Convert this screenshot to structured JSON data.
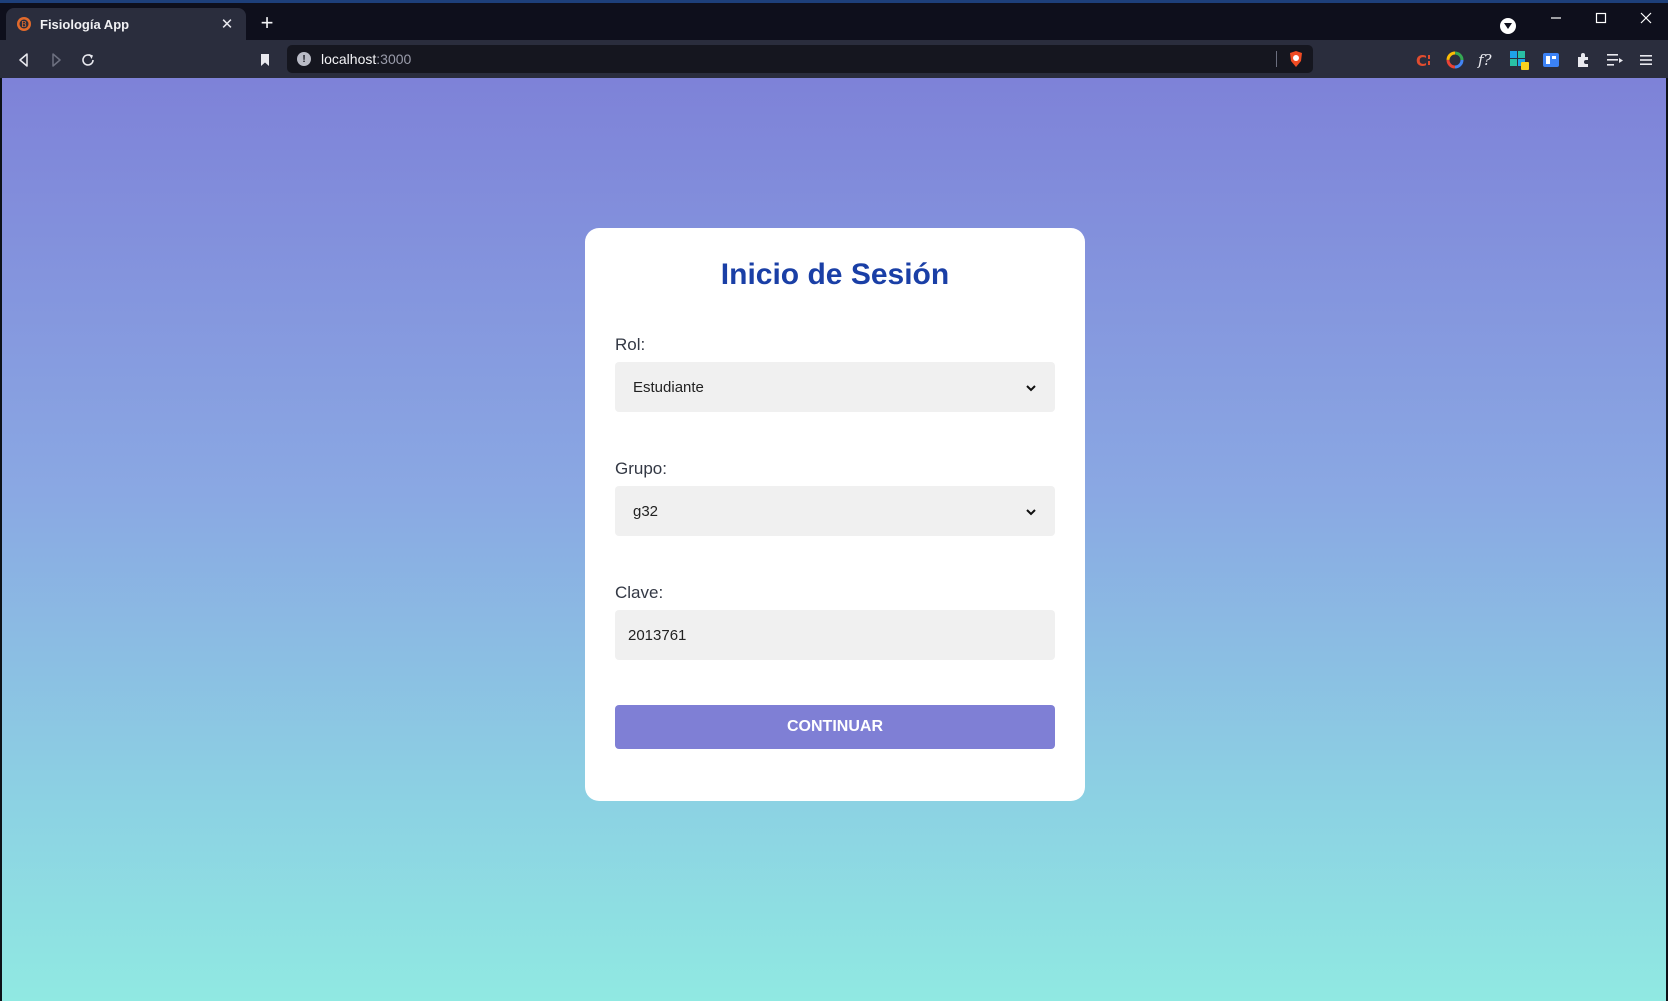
{
  "browser": {
    "tab": {
      "title": "Fisiología App",
      "favicon": "brave-lion-icon"
    },
    "new_tab_label": "+",
    "address": {
      "host": "localhost",
      "port": ":3000"
    },
    "window_controls": [
      "minimize-icon",
      "maximize-icon",
      "close-icon"
    ],
    "extensions": [
      "c-extension-icon",
      "color-wheel-icon",
      "function-icon",
      "puzzle-badge-extension-icon",
      "reader-icon",
      "extensions-puzzle-icon",
      "playlist-icon",
      "menu-icon"
    ]
  },
  "login": {
    "title": "Inicio de Sesión",
    "role": {
      "label": "Rol:",
      "value": "Estudiante"
    },
    "group": {
      "label": "Grupo:",
      "value": "g32"
    },
    "key": {
      "label": "Clave:",
      "value": "2013761"
    },
    "submit_label": "CONTINUAR"
  },
  "colors": {
    "accent": "#7f7fd5",
    "title": "#1a3fa6",
    "gradient_top": "#7e82d8",
    "gradient_bottom": "#90e9e2"
  }
}
